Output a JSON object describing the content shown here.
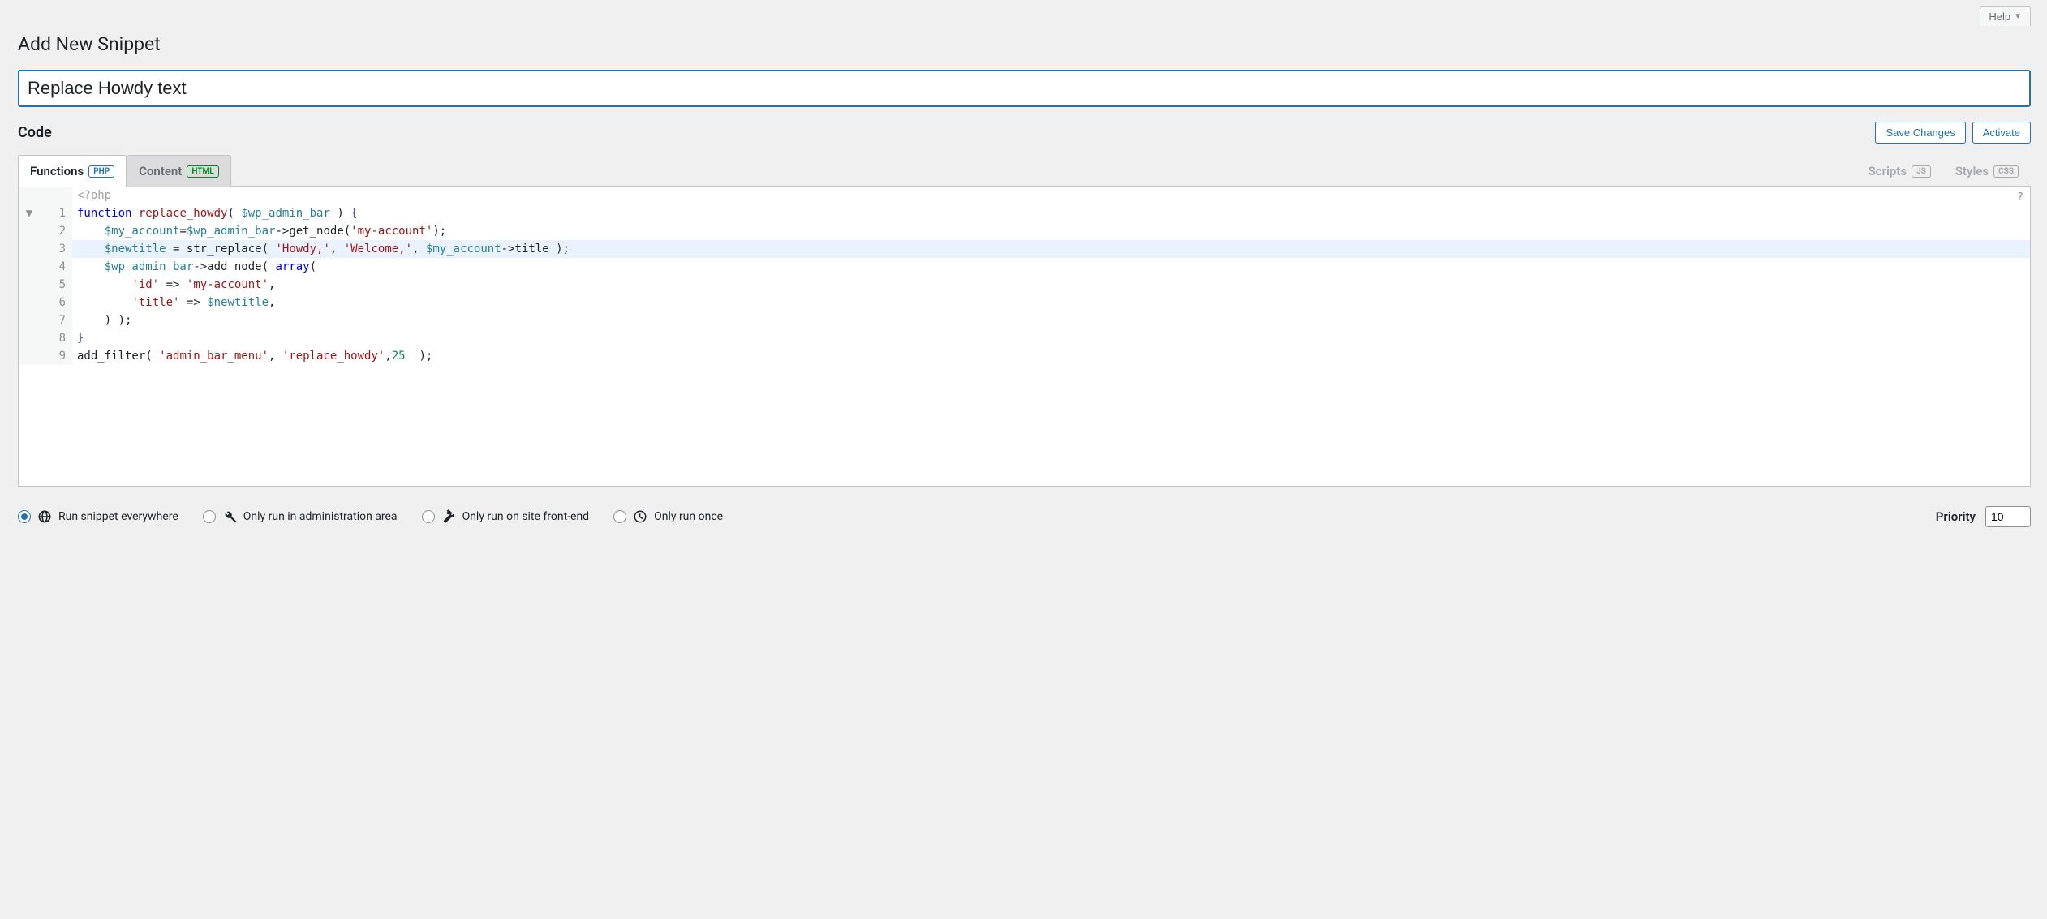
{
  "header": {
    "help_label": "Help",
    "page_title": "Add New Snippet",
    "title_value": "Replace Howdy text"
  },
  "code_section": {
    "heading": "Code",
    "save_label": "Save Changes",
    "activate_label": "Activate"
  },
  "tabs": {
    "functions": {
      "label": "Functions",
      "badge": "PHP"
    },
    "content": {
      "label": "Content",
      "badge": "HTML"
    },
    "scripts": {
      "label": "Scripts",
      "badge": "JS"
    },
    "styles": {
      "label": "Styles",
      "badge": "CSS"
    }
  },
  "editor": {
    "hint": "?",
    "opening_tag": "<?php",
    "highlighted_line": 3,
    "lines": [
      {
        "n": 1,
        "fold": "▼",
        "tokens": [
          {
            "c": "t-kw",
            "t": "function"
          },
          {
            "c": "t-plain",
            "t": " "
          },
          {
            "c": "t-fn",
            "t": "replace_howdy"
          },
          {
            "c": "t-plain",
            "t": "( "
          },
          {
            "c": "t-var",
            "t": "$wp_admin_bar"
          },
          {
            "c": "t-plain",
            "t": " ) "
          },
          {
            "c": "t-brace",
            "t": "{"
          }
        ]
      },
      {
        "n": 2,
        "tokens": [
          {
            "c": "t-plain",
            "t": "    "
          },
          {
            "c": "t-var",
            "t": "$my_account"
          },
          {
            "c": "t-op",
            "t": "="
          },
          {
            "c": "t-var",
            "t": "$wp_admin_bar"
          },
          {
            "c": "t-op",
            "t": "->"
          },
          {
            "c": "t-plain",
            "t": "get_node("
          },
          {
            "c": "t-str",
            "t": "'my-account'"
          },
          {
            "c": "t-plain",
            "t": ");"
          }
        ]
      },
      {
        "n": 3,
        "tokens": [
          {
            "c": "t-plain",
            "t": "    "
          },
          {
            "c": "t-var",
            "t": "$newtitle"
          },
          {
            "c": "t-plain",
            "t": " "
          },
          {
            "c": "t-op",
            "t": "="
          },
          {
            "c": "t-plain",
            "t": " str_replace( "
          },
          {
            "c": "t-str",
            "t": "'Howdy,'"
          },
          {
            "c": "t-plain",
            "t": ", "
          },
          {
            "c": "t-str",
            "t": "'Welcome,'"
          },
          {
            "c": "t-plain",
            "t": ", "
          },
          {
            "c": "t-var",
            "t": "$my_account"
          },
          {
            "c": "t-op",
            "t": "->"
          },
          {
            "c": "t-plain",
            "t": "title );"
          }
        ]
      },
      {
        "n": 4,
        "tokens": [
          {
            "c": "t-plain",
            "t": "    "
          },
          {
            "c": "t-var",
            "t": "$wp_admin_bar"
          },
          {
            "c": "t-op",
            "t": "->"
          },
          {
            "c": "t-plain",
            "t": "add_node( "
          },
          {
            "c": "t-kw",
            "t": "array"
          },
          {
            "c": "t-plain",
            "t": "("
          }
        ]
      },
      {
        "n": 5,
        "tokens": [
          {
            "c": "t-plain",
            "t": "        "
          },
          {
            "c": "t-str",
            "t": "'id'"
          },
          {
            "c": "t-plain",
            "t": " "
          },
          {
            "c": "t-op",
            "t": "=>"
          },
          {
            "c": "t-plain",
            "t": " "
          },
          {
            "c": "t-str",
            "t": "'my-account'"
          },
          {
            "c": "t-plain",
            "t": ","
          }
        ]
      },
      {
        "n": 6,
        "tokens": [
          {
            "c": "t-plain",
            "t": "        "
          },
          {
            "c": "t-str",
            "t": "'title'"
          },
          {
            "c": "t-plain",
            "t": " "
          },
          {
            "c": "t-op",
            "t": "=>"
          },
          {
            "c": "t-plain",
            "t": " "
          },
          {
            "c": "t-var",
            "t": "$newtitle"
          },
          {
            "c": "t-plain",
            "t": ","
          }
        ]
      },
      {
        "n": 7,
        "tokens": [
          {
            "c": "t-plain",
            "t": "    ) );"
          }
        ]
      },
      {
        "n": 8,
        "tokens": [
          {
            "c": "t-brace",
            "t": "}"
          }
        ]
      },
      {
        "n": 9,
        "tokens": [
          {
            "c": "t-plain",
            "t": "add_filter( "
          },
          {
            "c": "t-str",
            "t": "'admin_bar_menu'"
          },
          {
            "c": "t-plain",
            "t": ", "
          },
          {
            "c": "t-str",
            "t": "'replace_howdy'"
          },
          {
            "c": "t-plain",
            "t": ","
          },
          {
            "c": "t-num",
            "t": "25"
          },
          {
            "c": "t-plain",
            "t": "  );"
          }
        ]
      }
    ]
  },
  "scope": {
    "options": [
      {
        "id": "everywhere",
        "label": "Run snippet everywhere",
        "icon": "globe",
        "checked": true
      },
      {
        "id": "admin",
        "label": "Only run in administration area",
        "icon": "wrench",
        "checked": false
      },
      {
        "id": "frontend",
        "label": "Only run on site front-end",
        "icon": "hammer",
        "checked": false
      },
      {
        "id": "once",
        "label": "Only run once",
        "icon": "clock",
        "checked": false
      }
    ]
  },
  "priority": {
    "label": "Priority",
    "value": "10"
  }
}
